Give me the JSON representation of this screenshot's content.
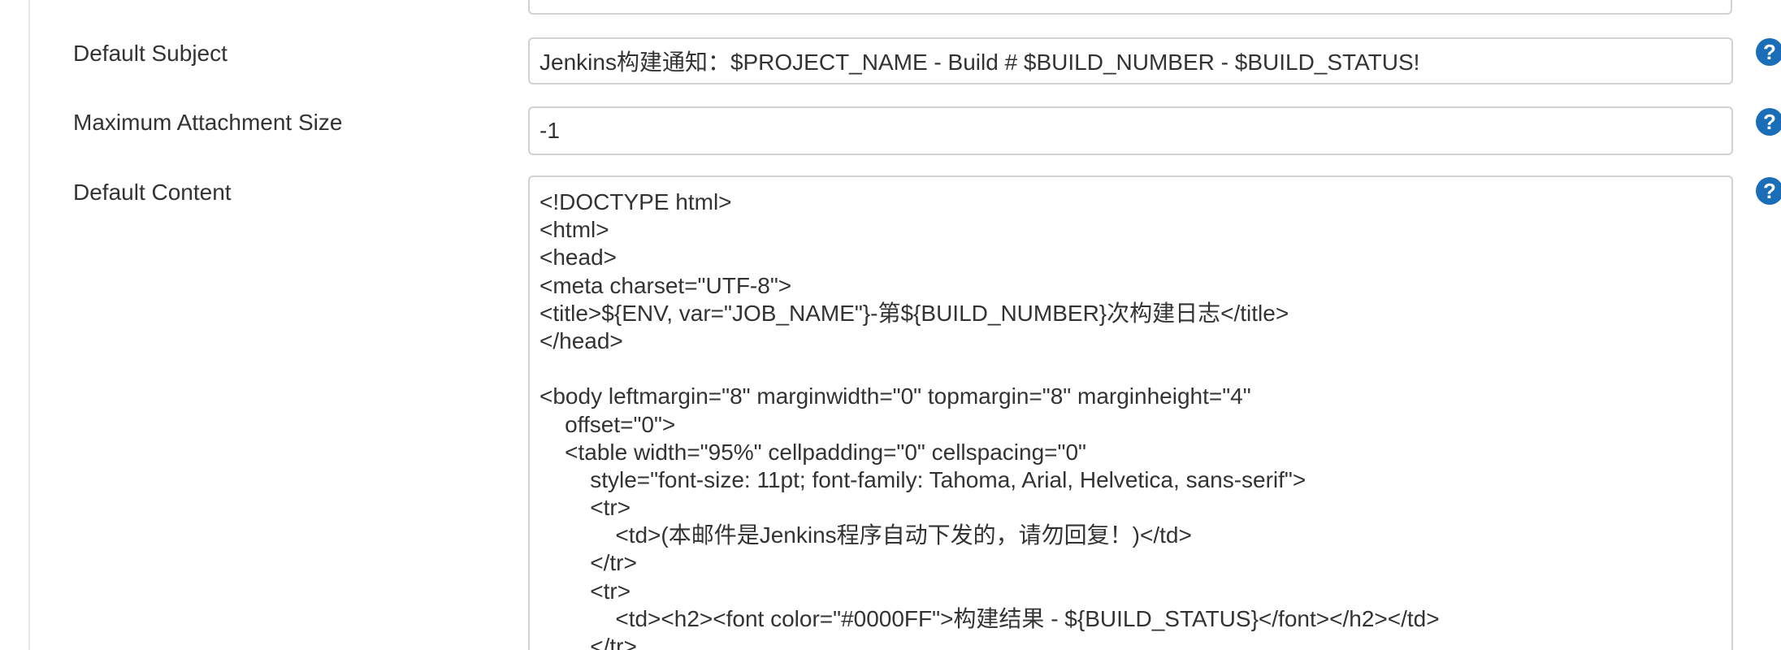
{
  "form": {
    "subject": {
      "label": "Default Subject",
      "value": "Jenkins构建通知：$PROJECT_NAME - Build # $BUILD_NUMBER - $BUILD_STATUS!"
    },
    "attachment": {
      "label": "Maximum Attachment Size",
      "value": "-1"
    },
    "content": {
      "label": "Default Content",
      "lines": [
        "<!DOCTYPE html>",
        "<html>",
        "<head>",
        "<meta charset=\"UTF-8\">",
        "<title>${ENV, var=\"JOB_NAME\"}-第${BUILD_NUMBER}次构建日志</title>",
        "</head>",
        "",
        "<body leftmargin=\"8\" marginwidth=\"0\" topmargin=\"8\" marginheight=\"4\"",
        "    offset=\"0\">",
        "    <table width=\"95%\" cellpadding=\"0\" cellspacing=\"0\"",
        "        style=\"font-size: 11pt; font-family: Tahoma, Arial, Helvetica, sans-serif\">",
        "        <tr>",
        "            <td>(本邮件是Jenkins程序自动下发的，请勿回复！)</td>",
        "        </tr>",
        "        <tr>",
        "            <td><h2><font color=\"#0000FF\">构建结果 - ${BUILD_STATUS}</font></h2></td>",
        "        </tr>"
      ]
    },
    "help_glyph": "?"
  },
  "colors": {
    "help_icon": "#1a6eb8",
    "field_border": "#d2d2d2",
    "text": "#333333"
  },
  "icons": [
    "help-icon"
  ]
}
